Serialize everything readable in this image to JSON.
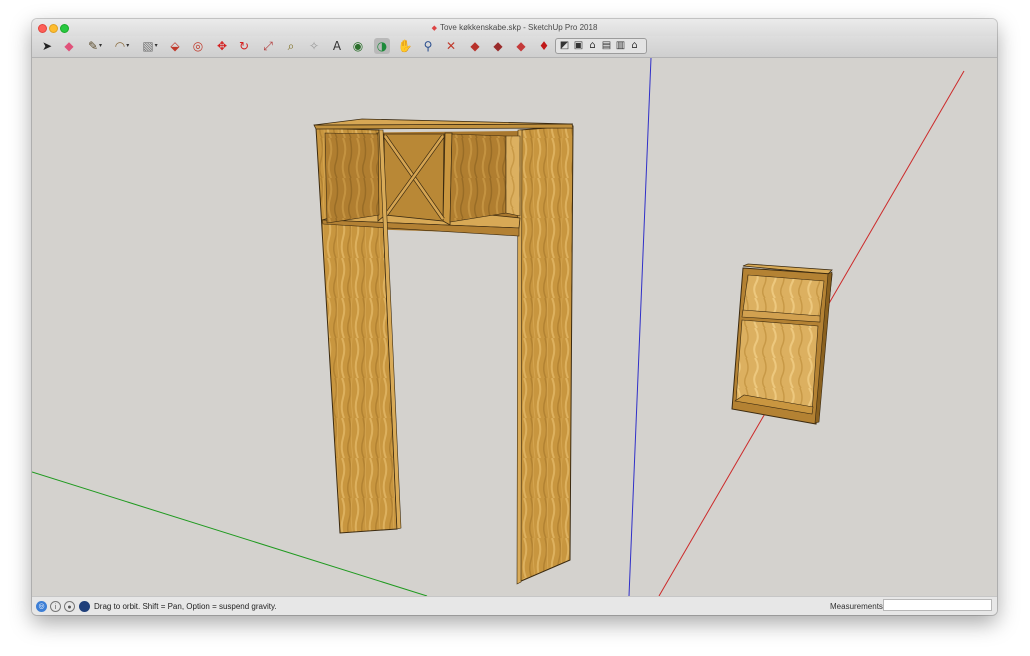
{
  "window": {
    "title": "Tove køkkenskabe.skp - SketchUp Pro 2018"
  },
  "toolbar": {
    "tools": [
      {
        "name": "select-tool",
        "glyph": "➤",
        "color": "#222222"
      },
      {
        "name": "eraser-tool",
        "glyph": "◆",
        "color": "#e0527a"
      },
      {
        "name": "line-tool",
        "glyph": "✎",
        "color": "#5a4a2a",
        "dropdown": true
      },
      {
        "name": "arc-tool",
        "glyph": "◠",
        "color": "#8a6a3a",
        "dropdown": true
      },
      {
        "name": "shape-tool",
        "glyph": "▧",
        "color": "#6f6f6f",
        "dropdown": true
      },
      {
        "name": "push-pull-tool",
        "glyph": "⬙",
        "color": "#c0392b"
      },
      {
        "name": "offset-tool",
        "glyph": "◎",
        "color": "#c0392b"
      },
      {
        "name": "move-tool",
        "glyph": "✥",
        "color": "#d42020"
      },
      {
        "name": "rotate-tool",
        "glyph": "↻",
        "color": "#d42020"
      },
      {
        "name": "scale-tool",
        "glyph": "⤢",
        "color": "#b23b3b"
      },
      {
        "name": "tape-measure-tool",
        "glyph": "⌕",
        "color": "#7a6a1a"
      },
      {
        "name": "protractor-tool",
        "glyph": "✧",
        "color": "#999999"
      },
      {
        "name": "text-tool",
        "glyph": "A",
        "color": "#333333"
      },
      {
        "name": "paint-bucket-tool",
        "glyph": "◉",
        "color": "#2a6e2a"
      },
      {
        "name": "orbit-tool",
        "glyph": "◑",
        "color": "#1d8a3a",
        "active": true
      },
      {
        "name": "pan-tool",
        "glyph": "✋",
        "color": "#b58a3a"
      },
      {
        "name": "zoom-tool",
        "glyph": "⚲",
        "color": "#2b4f8f"
      },
      {
        "name": "zoom-extents-tool",
        "glyph": "✕",
        "color": "#c0392b"
      },
      {
        "name": "3d-warehouse-icon",
        "glyph": "◆",
        "color": "#b8322b"
      },
      {
        "name": "extension-warehouse-icon",
        "glyph": "◆",
        "color": "#9a2b2b"
      },
      {
        "name": "layout-icon",
        "glyph": "◆",
        "color": "#c43a3a"
      },
      {
        "name": "ruby-console-icon",
        "glyph": "♦",
        "color": "#c01818"
      }
    ],
    "views": [
      {
        "name": "iso-view-icon",
        "glyph": "◩"
      },
      {
        "name": "top-view-icon",
        "glyph": "▣"
      },
      {
        "name": "front-view-icon",
        "glyph": "⌂"
      },
      {
        "name": "right-view-icon",
        "glyph": "▤"
      },
      {
        "name": "back-view-icon",
        "glyph": "▥"
      },
      {
        "name": "left-view-icon",
        "glyph": "⌂"
      }
    ]
  },
  "status": {
    "hint": "Drag to orbit. Shift = Pan, Option = suspend gravity.",
    "measurements_label": "Measurements",
    "measurements_value": ""
  },
  "colors": {
    "axis_red": "#cc2a2a",
    "axis_green": "#1f9a1f",
    "axis_blue": "#3030c8",
    "wood_light": "#d2a24c",
    "wood_mid": "#bf8f38",
    "wood_dark": "#8e6425",
    "background": "#d4d2ce"
  }
}
